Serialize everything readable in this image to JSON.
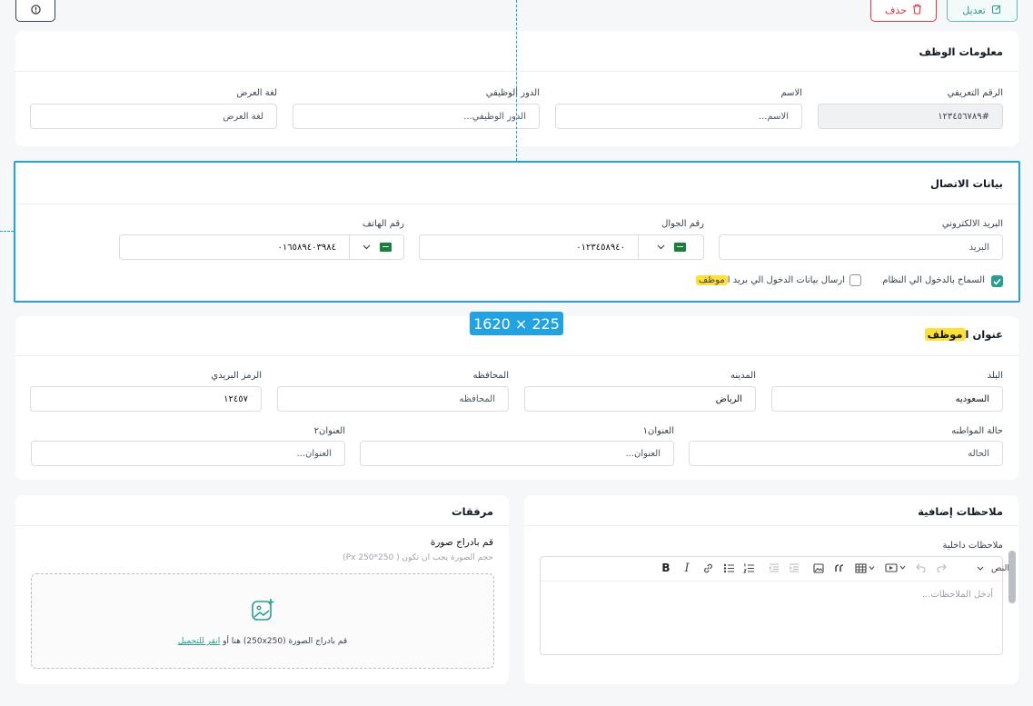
{
  "toolbar": {
    "edit_label": "تعديل",
    "delete_label": "حذف",
    "info_icon": "info-icon"
  },
  "employee": {
    "title": "معلومات الوظف",
    "id_label": "الرقم التعريفي",
    "id_value": "#١٢٣٤٥٦٧٨٩",
    "name_label": "الاسم",
    "name_placeholder": "الاسم...",
    "role_label": "الدور الوظيفي",
    "role_placeholder": "الدور الوظيفي...",
    "lang_label": "لغة العرض",
    "lang_placeholder": "لغة العرض"
  },
  "contact": {
    "title": "بيانات الاتصال",
    "email_label": "البريد الالكتروني",
    "email_placeholder": "البريد",
    "mobile_label": "رقم الجوال",
    "mobile_value": "٠١٢٣٤٥٨٩٤٠",
    "phone_label": "رقم الهاتف",
    "phone_value": "٠١٦٥٨٩٤٠٣٩٨٤",
    "allow_login_label": "السماح بالدخول الي النظام",
    "allow_login_checked": true,
    "send_credentials_label": "ارسال بيانات الدخول الي بريد ا",
    "send_credentials_highlight": "موظف",
    "send_credentials_checked": false
  },
  "overlay": {
    "size_badge": "1620 × 225"
  },
  "address": {
    "title_prefix": "عنوان ا",
    "title_highlight": "موظف",
    "country_label": "البلد",
    "country_value": "السعوديه",
    "city_label": "المدينه",
    "city_value": "الرياض",
    "province_label": "المحافظه",
    "province_placeholder": "المحافظه",
    "zip_label": "الرمز البريدي",
    "zip_value": "١٢٤٥٧",
    "citizenship_label": "حالة المواطنه",
    "citizenship_placeholder": "الحاله",
    "address1_label": "العنوان١",
    "address1_placeholder": "العنوان...",
    "address2_label": "العنوان٢",
    "address2_placeholder": "العنوان..."
  },
  "notes": {
    "title": "ملاحظات إضافية",
    "internal_label": "ملاحظات داخلية",
    "format_select": "النص",
    "placeholder": "أدخل الملاحظات..."
  },
  "attachments": {
    "title": "مرفقات",
    "upload_title": "قم بادراج صورة",
    "upload_hint": "حجم الصورة يجب ان تكون ( 250*250 Px)",
    "dropzone_text": "قم بادراج الصورة (250x250) هنا أو",
    "dropzone_link": "انقر للتحميل"
  },
  "colors": {
    "accent": "#22a2e0",
    "teal": "#2a9d8f",
    "danger": "#dc3545",
    "highlight": "#ffe03b"
  }
}
